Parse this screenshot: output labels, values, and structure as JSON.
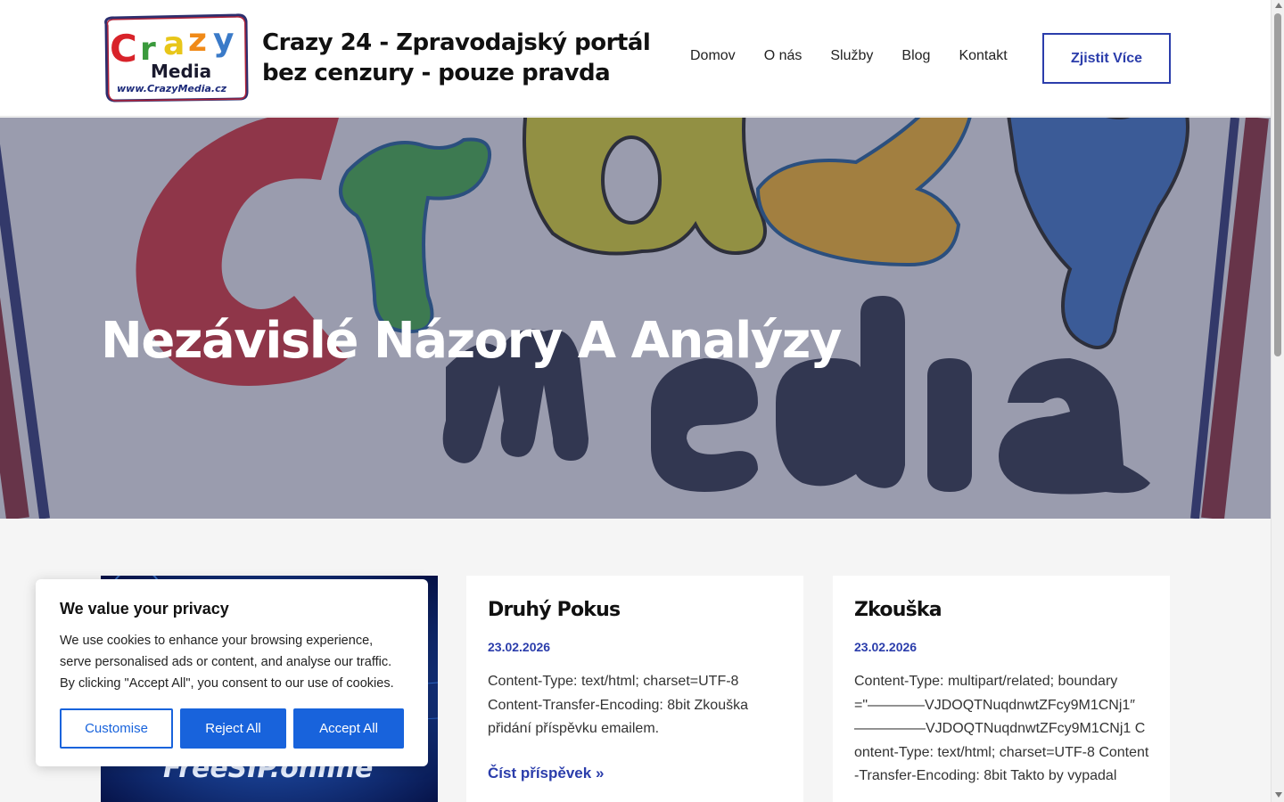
{
  "header": {
    "site_title": "Crazy 24 - Zpravodajský portál bez cenzury - pouze pravda",
    "logo_text_top": "Crazy",
    "logo_text_bottom": "Media",
    "logo_url_text": "www.CrazyMedia.cz",
    "nav": [
      "Domov",
      "O nás",
      "Služby",
      "Blog",
      "Kontakt"
    ],
    "cta_label": "Zjistit Více"
  },
  "hero": {
    "title": "Nezávislé Názory A Analýzy"
  },
  "posts": [
    {
      "image_text": "FreeSIP.online"
    },
    {
      "title": "Druhý Pokus",
      "date": "23.02.2026",
      "excerpt": "Content-Type: text/html; charset=UTF-8 Content-Transfer-Encoding: 8bit Zkouška přidání příspěvku emailem.",
      "link": "Číst příspěvek »"
    },
    {
      "title": "Zkouška",
      "date": "23.02.2026",
      "excerpt": "Content-Type: multipart/related; boundary=\"————VJDOQTNuqdnwtZFcy9M1CNj1″ —————VJDOQTNuqdnwtZFcy9M1CNj1 Content-Type: text/html; charset=UTF-8 Content-Transfer-Encoding: 8bit Takto by vypadal"
    }
  ],
  "cookie": {
    "title": "We value your privacy",
    "text": "We use cookies to enhance your browsing experience, serve personalised ads or content, and analyse our traffic. By clicking \"Accept All\", you consent to our use of cookies.",
    "customise": "Customise",
    "reject": "Reject All",
    "accept": "Accept All"
  },
  "colors": {
    "accent": "#2b3dab",
    "cookie_button": "#1863dc"
  }
}
